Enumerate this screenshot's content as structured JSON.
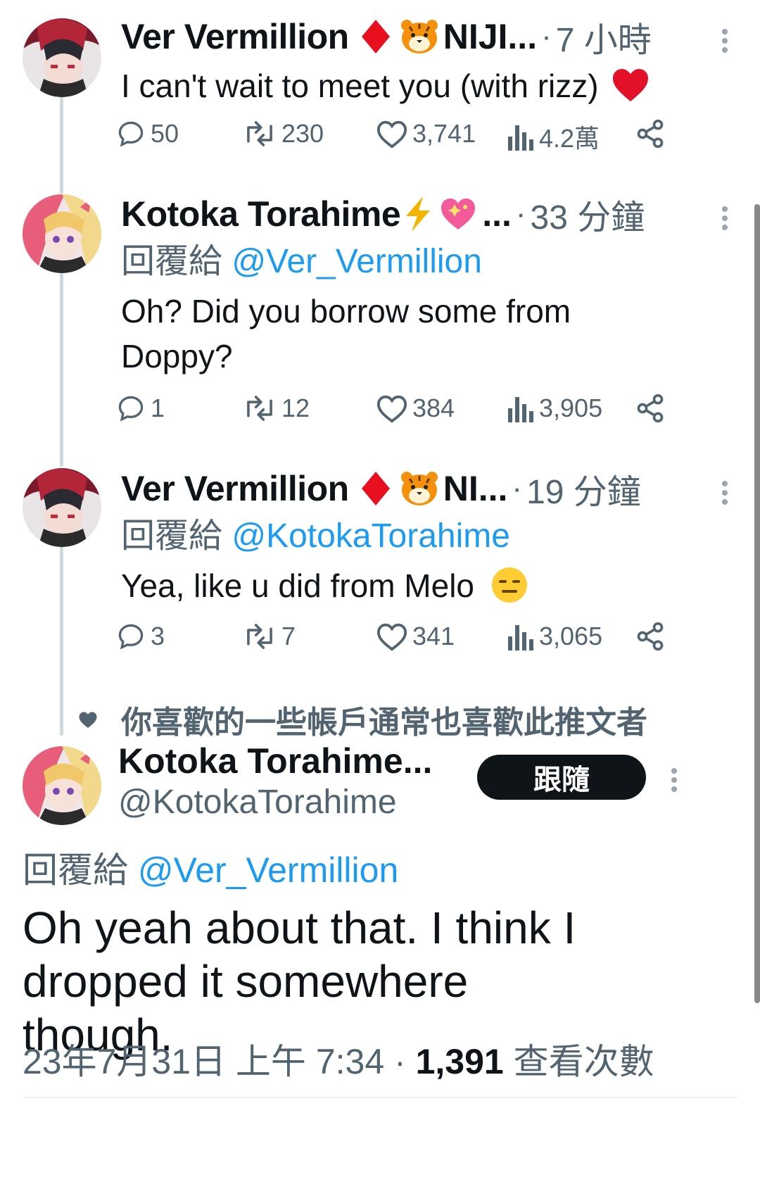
{
  "tweets": [
    {
      "name": "Ver Vermillion",
      "name_truncated": "NIJI...",
      "time": "7 小時",
      "text": "I can't wait to meet you (with rizz)",
      "replies": "50",
      "retweets": "230",
      "likes": "3,741",
      "views": "4.2萬"
    },
    {
      "name": "Kotoka Torahime",
      "name_truncated": "...",
      "time": "33 分鐘",
      "reply_prefix": "回覆給",
      "reply_handle": "@Ver_Vermillion",
      "text": "Oh? Did you borrow some from Doppy?",
      "replies": "1",
      "retweets": "12",
      "likes": "384",
      "views": "3,905"
    },
    {
      "name": "Ver Vermillion",
      "name_truncated": "NI...",
      "time": "19 分鐘",
      "reply_prefix": "回覆給",
      "reply_handle": "@KotokaTorahime",
      "text": "Yea, like u did from Melo",
      "replies": "3",
      "retweets": "7",
      "likes": "341",
      "views": "3,065"
    }
  ],
  "social_context": "你喜歡的一些帳戶通常也喜歡此推文者",
  "main_tweet": {
    "name": "Kotoka Torahime...",
    "handle": "@KotokaTorahime",
    "follow_label": "跟隨",
    "reply_prefix": "回覆給",
    "reply_handle": "@Ver_Vermillion",
    "text": "Oh yeah about that. I think I dropped it somewhere though.",
    "date": "23年7月31日 上午 7:34",
    "separator": "·",
    "views_count": "1,391",
    "views_label": "查看次數"
  },
  "icons": [
    "reply-icon",
    "retweet-icon",
    "like-icon",
    "views-icon",
    "share-icon",
    "more-icon",
    "heart-icon",
    "red-diamond-icon",
    "tiger-icon",
    "lightning-icon",
    "sparkling-heart-icon",
    "red-heart-icon",
    "expressionless-face-icon"
  ],
  "colors": {
    "link": "#1d9bf0",
    "secondary": "#536471",
    "text": "#0f1419",
    "thread_line": "#cfd9de"
  }
}
